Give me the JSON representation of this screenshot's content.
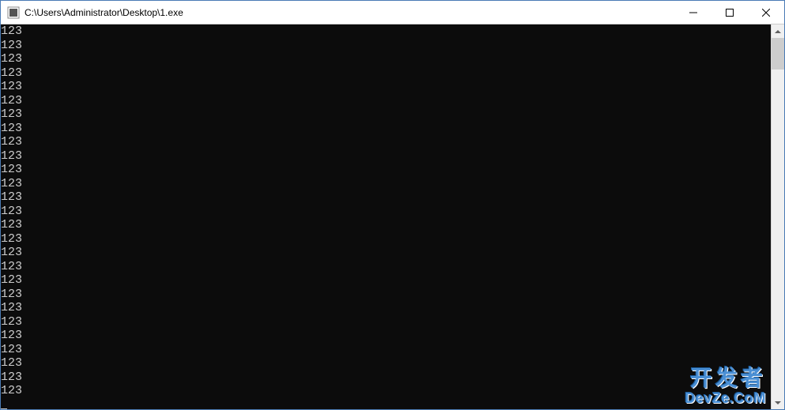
{
  "window": {
    "title": "C:\\Users\\Administrator\\Desktop\\1.exe"
  },
  "console": {
    "lines": [
      "123",
      "123",
      "123",
      "123",
      "123",
      "123",
      "123",
      "123",
      "123",
      "123",
      "123",
      "123",
      "123",
      "123",
      "123",
      "123",
      "123",
      "123",
      "123",
      "123",
      "123",
      "123",
      "123",
      "123",
      "123",
      "123",
      "123"
    ]
  },
  "watermark": {
    "cn": "开发者",
    "en": "DevZe.CoM"
  }
}
